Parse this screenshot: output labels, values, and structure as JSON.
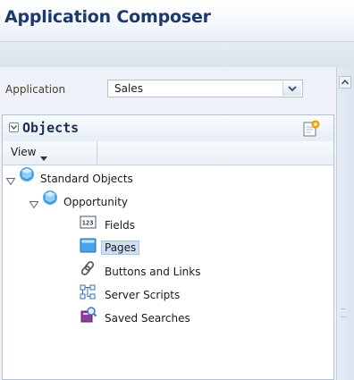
{
  "header": {
    "title": "Application Composer"
  },
  "application": {
    "label": "Application",
    "selected": "Sales"
  },
  "objects_panel": {
    "title": "Objects",
    "view_menu": "View"
  },
  "tree": {
    "root": {
      "label": "Standard Objects",
      "expanded": true
    },
    "object": {
      "label": "Opportunity",
      "expanded": true
    },
    "children": [
      {
        "label": "Fields",
        "icon": "fields-icon",
        "selected": false
      },
      {
        "label": "Pages",
        "icon": "pages-icon",
        "selected": true
      },
      {
        "label": "Buttons and Links",
        "icon": "link-icon",
        "selected": false
      },
      {
        "label": "Server Scripts",
        "icon": "server-scripts-icon",
        "selected": false
      },
      {
        "label": "Saved Searches",
        "icon": "saved-searches-icon",
        "selected": false
      }
    ]
  },
  "colors": {
    "title": "#1b3a6b",
    "selection": "#cfe0f5",
    "panel_bg": "#eef2f8"
  }
}
